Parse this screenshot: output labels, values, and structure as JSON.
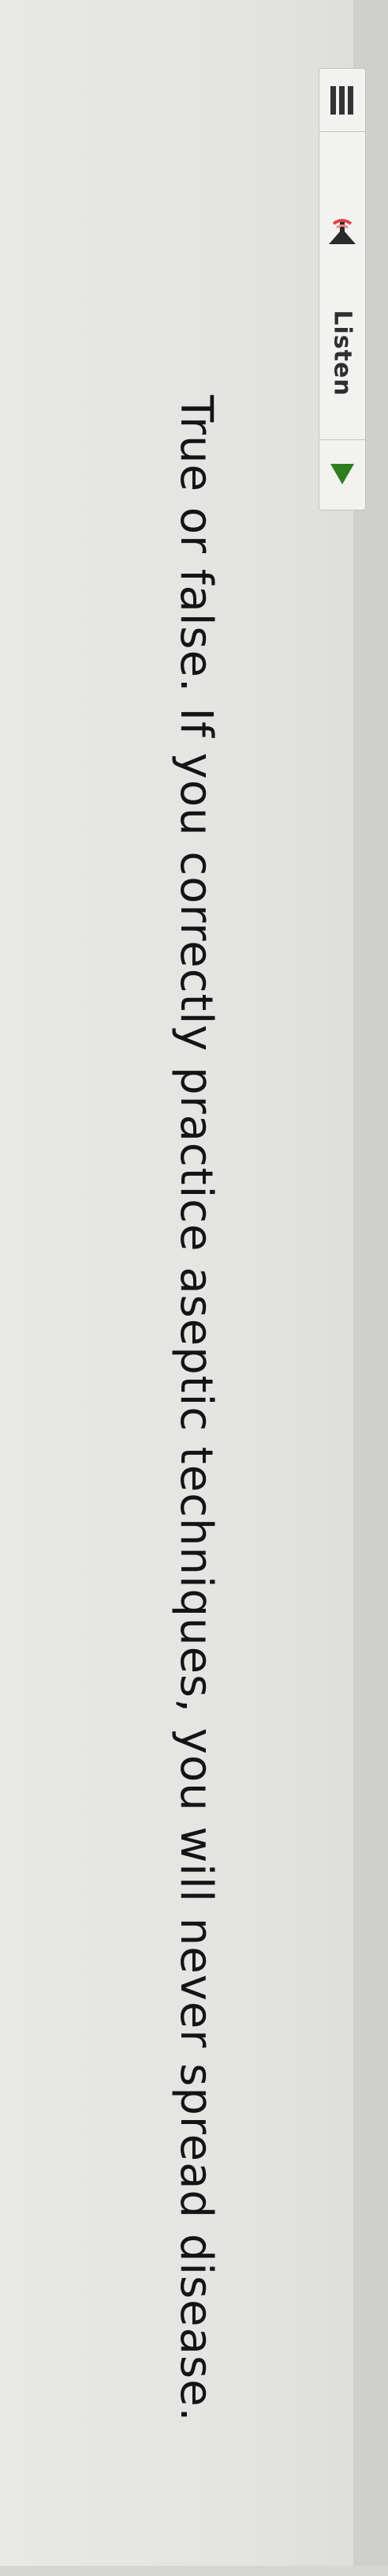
{
  "toolbar": {
    "menu_icon": "hamburger-menu-icon",
    "speaker_icon": "speaker-icon",
    "listen_label": "Listen",
    "play_icon": "play-triangle-icon",
    "play_color": "#2e7d1e",
    "speaker_color": "#2a2a2a",
    "speaker_accent": "#d44"
  },
  "question": {
    "text": "True or false. If you correctly practice aseptic techniques, you will never spread disease."
  }
}
